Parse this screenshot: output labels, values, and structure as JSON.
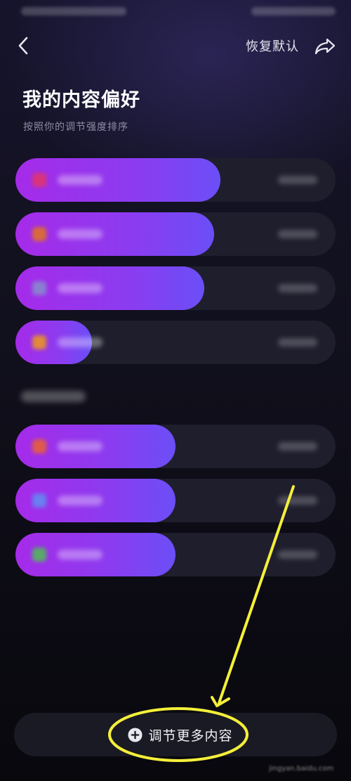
{
  "header": {
    "reset_label": "恢复默认",
    "back_icon": "chevron-left-icon",
    "share_icon": "share-arrow-icon"
  },
  "page": {
    "title": "我的内容偏好",
    "subtitle": "按照你的调节强度排序"
  },
  "preferences": [
    {
      "level": 0.64,
      "icon_color": "#d9347a"
    },
    {
      "level": 0.62,
      "icon_color": "#d86a3a"
    },
    {
      "level": 0.59,
      "icon_color": "#8a7fd0"
    },
    {
      "level": 0.24,
      "icon_color": "#e08a3a"
    }
  ],
  "secondary_preferences": [
    {
      "level": 0.5,
      "icon_color": "#e05a4a"
    },
    {
      "level": 0.5,
      "icon_color": "#6a7ff0"
    },
    {
      "level": 0.5,
      "icon_color": "#5aa86a"
    }
  ],
  "footer": {
    "add_more_label": "调节更多内容",
    "add_icon": "plus-circle-icon"
  },
  "colors": {
    "accent_start": "#a52be9",
    "accent_end": "#6b4ff7",
    "annotation": "#f4ef3a"
  }
}
